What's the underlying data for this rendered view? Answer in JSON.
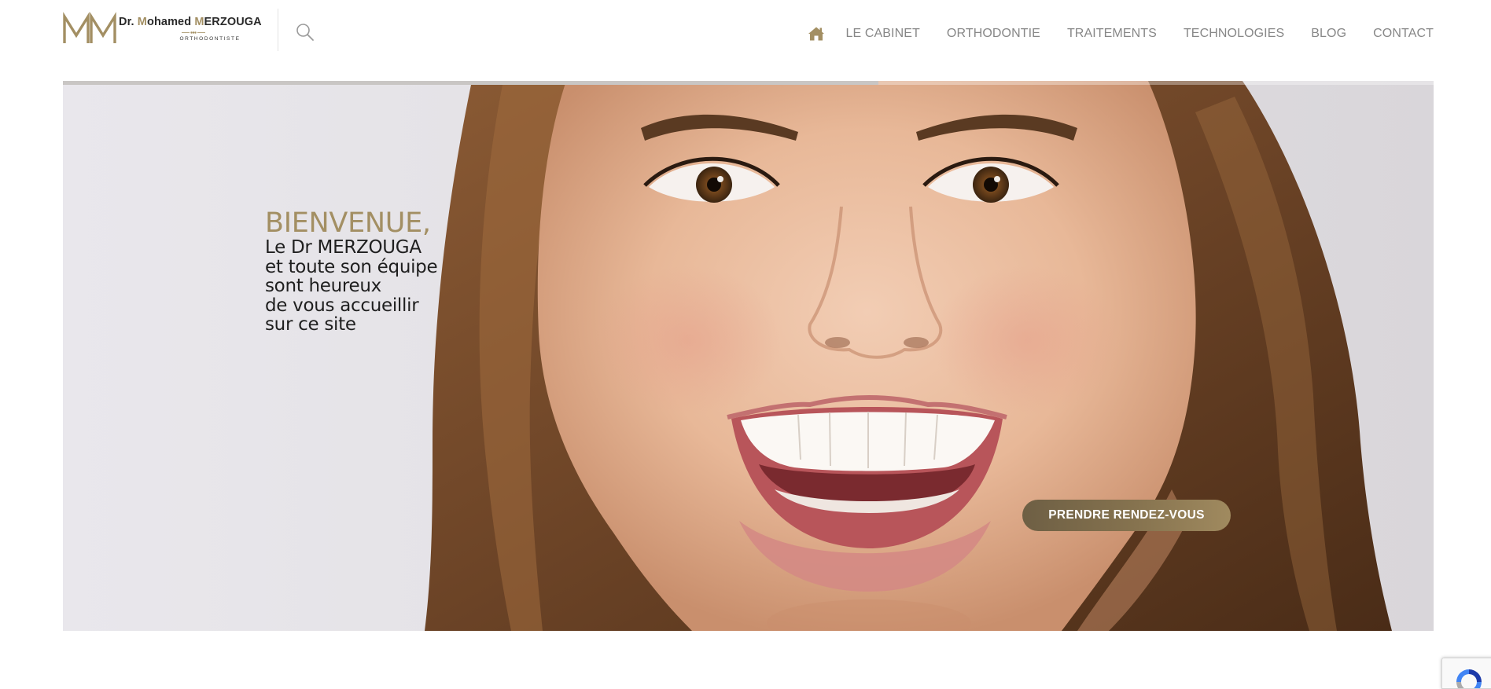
{
  "brand": {
    "monogram": "MM",
    "name_prefix": "Dr.",
    "name_first_initial": "M",
    "name_first_rest": "ohamed",
    "name_last_initial": "M",
    "name_last_rest": "ERZOUGA",
    "subtitle": "ORTHODONTISTE"
  },
  "header": {
    "search_icon": "search-icon",
    "home_icon": "home-icon",
    "nav": [
      "LE CABINET",
      "ORTHODONTIE",
      "TRAITEMENTS",
      "TECHNOLOGIES",
      "BLOG",
      "CONTACT"
    ]
  },
  "hero": {
    "slider_progress": 0.595,
    "welcome": "BIENVENUE,",
    "lines": [
      "Le Dr MERZOUGA",
      "et toute son équipe",
      "sont heureux",
      "de vous accueillir",
      "sur ce site"
    ],
    "cta_label": "PRENDRE RENDEZ-VOUS"
  },
  "colors": {
    "accent_gold": "#a38f63",
    "nav_text": "#878787",
    "hero_text": "#1f1f1f"
  },
  "widgets": {
    "recaptcha_icon": "recaptcha-icon"
  }
}
